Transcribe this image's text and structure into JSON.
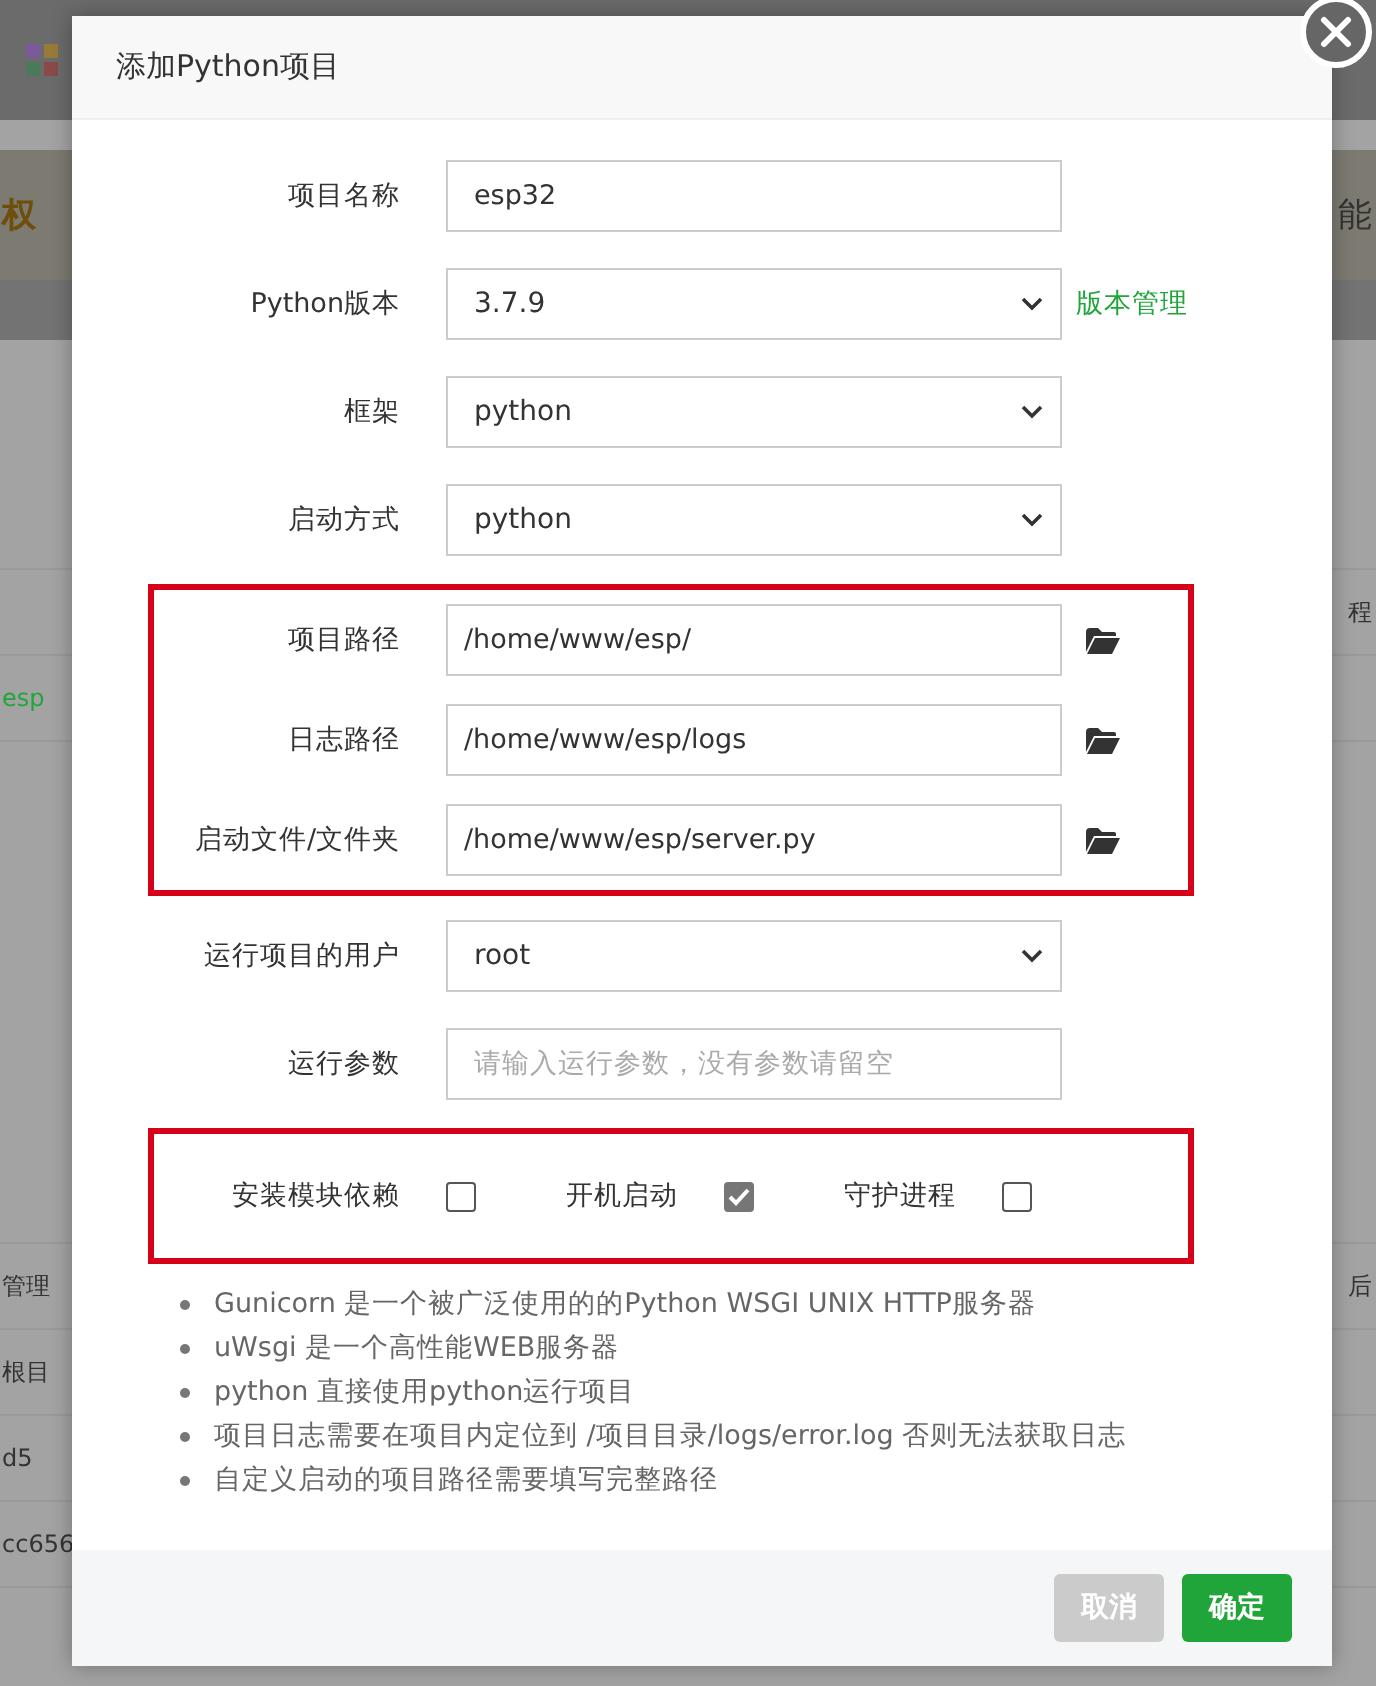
{
  "background_rows": [
    {
      "kind": "topbar"
    },
    {
      "kind": "banner",
      "left": "权",
      "right": "能"
    },
    {
      "kind": "strip"
    },
    {
      "kind": "gap"
    },
    {
      "kind": "row",
      "right": "程"
    },
    {
      "kind": "row",
      "left": "esp",
      "color": "#20a53a"
    },
    {
      "kind": "tall"
    },
    {
      "kind": "row",
      "left": "管理",
      "right": "后"
    },
    {
      "kind": "row",
      "left": "根目"
    },
    {
      "kind": "row",
      "left": "d5"
    },
    {
      "kind": "row",
      "left": "cc656"
    }
  ],
  "dialog": {
    "title": "添加Python项目",
    "sections": [
      {
        "highlighted": false,
        "rows": [
          {
            "kind": "text",
            "label": "项目名称",
            "value": "esp32"
          },
          {
            "kind": "select",
            "label": "Python版本",
            "value": "3.7.9",
            "link": "版本管理"
          },
          {
            "kind": "select",
            "label": "框架",
            "value": "python"
          },
          {
            "kind": "select",
            "label": "启动方式",
            "value": "python"
          }
        ]
      },
      {
        "highlighted": true,
        "rows": [
          {
            "kind": "path",
            "label": "项目路径",
            "value": "/home/www/esp/"
          },
          {
            "kind": "path",
            "label": "日志路径",
            "value": "/home/www/esp/logs"
          },
          {
            "kind": "path",
            "label": "启动文件/文件夹",
            "value": "/home/www/esp/server.py"
          }
        ]
      },
      {
        "highlighted": false,
        "rows": [
          {
            "kind": "select",
            "label": "运行项目的用户",
            "value": "root"
          },
          {
            "kind": "text",
            "label": "运行参数",
            "placeholder": "请输入运行参数，没有参数请留空"
          }
        ]
      },
      {
        "highlighted": true,
        "checkboxes": [
          {
            "label": "安装模块依赖",
            "checked": false
          },
          {
            "label": "开机启动",
            "checked": true
          },
          {
            "label": "守护进程",
            "checked": false
          }
        ]
      }
    ],
    "notes": [
      "Gunicorn 是一个被广泛使用的的Python WSGI UNIX HTTP服务器",
      "uWsgi 是一个高性能WEB服务器",
      "python 直接使用python运行项目",
      "项目日志需要在项目内定位到 /项目目录/logs/error.log 否则无法获取日志",
      "自定义启动的项目路径需要填写完整路径"
    ],
    "buttons": [
      {
        "label": "取消",
        "kind": "cancel"
      },
      {
        "label": "确定",
        "kind": "primary"
      }
    ]
  }
}
